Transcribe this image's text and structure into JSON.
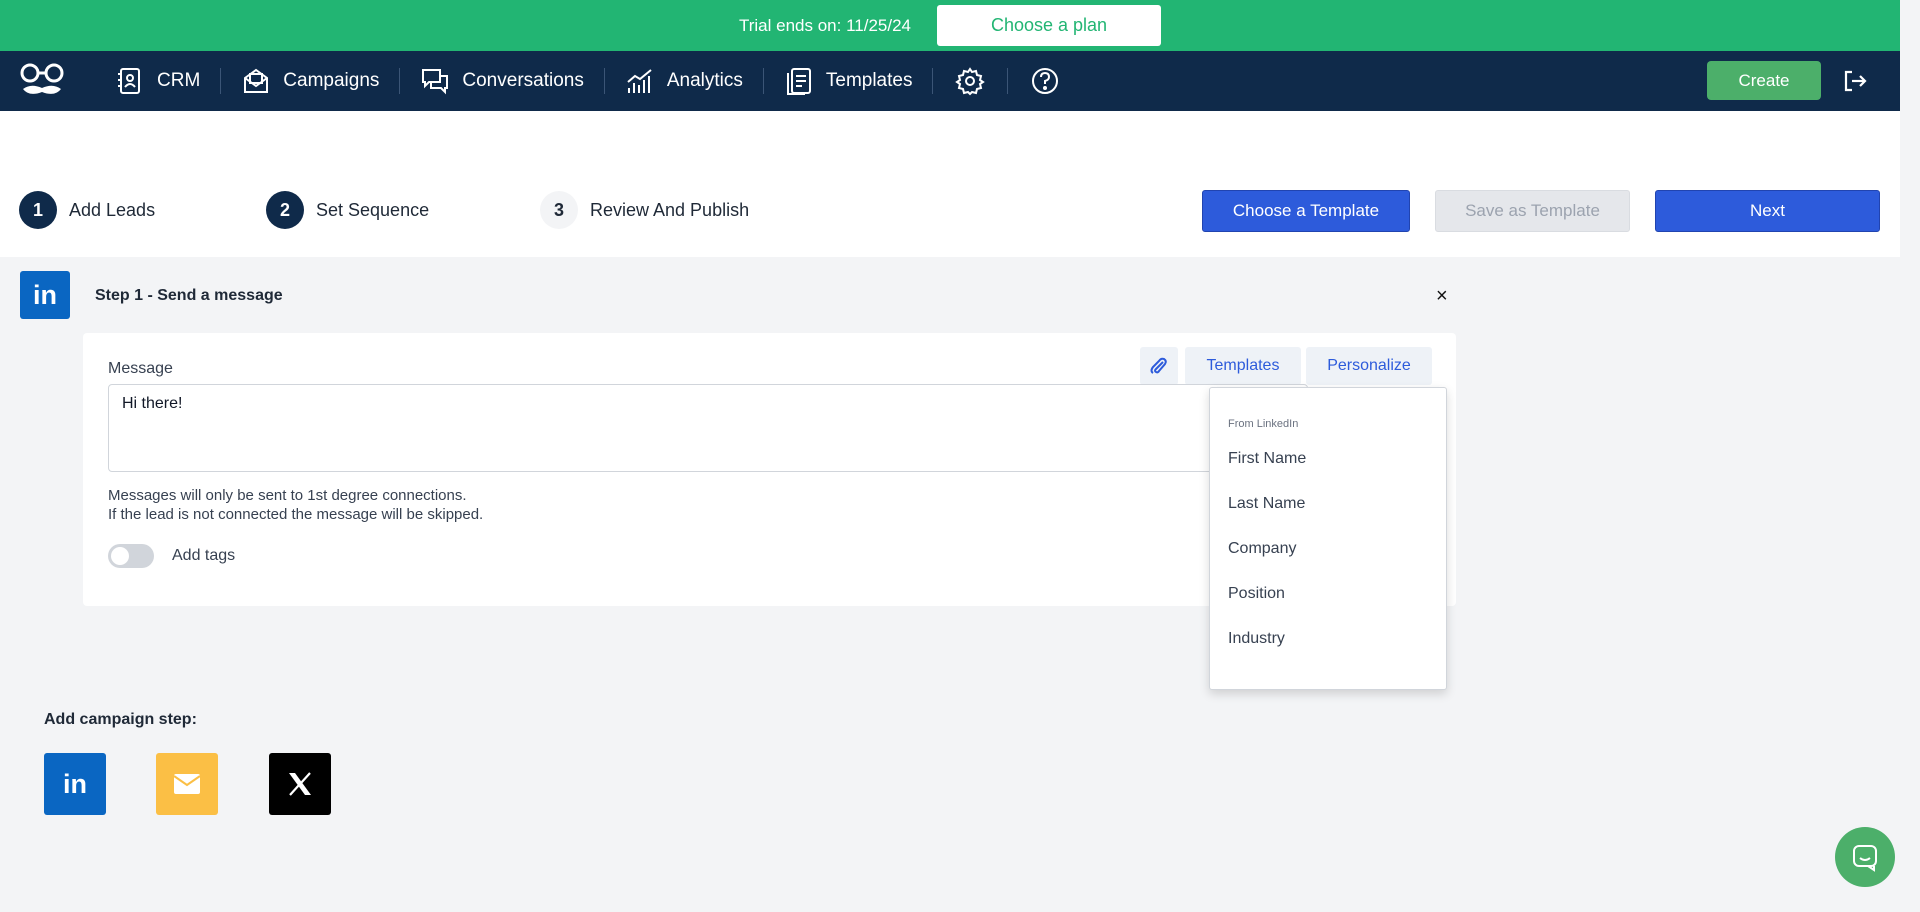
{
  "banner": {
    "trial_text": "Trial ends on: 11/25/24",
    "choose_plan_label": "Choose a plan"
  },
  "nav": {
    "items": [
      {
        "label": "CRM",
        "icon": "crm-icon"
      },
      {
        "label": "Campaigns",
        "icon": "campaigns-icon"
      },
      {
        "label": "Conversations",
        "icon": "conversations-icon"
      },
      {
        "label": "Analytics",
        "icon": "analytics-icon"
      },
      {
        "label": "Templates",
        "icon": "templates-icon"
      }
    ],
    "icons": [
      "gear-icon",
      "help-icon",
      "logout-icon"
    ],
    "create_label": "Create"
  },
  "steps": {
    "items": [
      {
        "num": "1",
        "label": "Add Leads"
      },
      {
        "num": "2",
        "label": "Set Sequence"
      },
      {
        "num": "3",
        "label": "Review And Publish"
      }
    ],
    "choose_template_label": "Choose a Template",
    "save_template_label": "Save as Template",
    "next_label": "Next"
  },
  "step1": {
    "badge": "in",
    "title": "Step 1 - Send a message",
    "close": "×",
    "message_label": "Message",
    "templates_tab": "Templates",
    "personalize_tab": "Personalize",
    "message_value": "Hi there!",
    "hint_line1": "Messages will only be sent to 1st degree connections.",
    "hint_line2": "If the lead is not connected the message will be skipped.",
    "add_tags_label": "Add tags"
  },
  "dropdown": {
    "header": "From LinkedIn",
    "items": [
      "First Name",
      "Last Name",
      "Company",
      "Position",
      "Industry"
    ]
  },
  "campaign_steps": {
    "label": "Add campaign step:",
    "linkedin_text": "in"
  },
  "colors": {
    "banner": "#22b573",
    "nav": "#0f2a4a",
    "primary": "#2d5bdb",
    "create": "#4caf6a",
    "linkedin": "#0a66c2",
    "email": "#fbbf45"
  }
}
